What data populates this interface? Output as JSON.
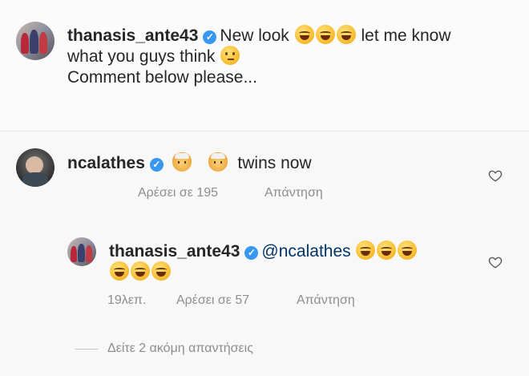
{
  "post": {
    "username": "thanasis_ante43",
    "caption_line1": "New look",
    "caption_line1b": "let me know",
    "caption_line2": "what you guys think",
    "caption_line3": "Comment below please..."
  },
  "comment": {
    "username": "ncalathes",
    "text": "twins now",
    "likes": "Αρέσει σε 195",
    "reply_label": "Απάντηση"
  },
  "reply": {
    "username": "thanasis_ante43",
    "mention": "@ncalathes",
    "time": "19λεπ.",
    "likes": "Αρέσει σε 57",
    "reply_label": "Απάντηση"
  },
  "view_more": "Δείτε 2 ακόμη απαντήσεις",
  "colors": {
    "verified": "#3897f0",
    "meta": "#8e8e8e",
    "mention": "#003569"
  },
  "icons": [
    "verified-badge-icon",
    "laughing-emoji-icon",
    "thinking-emoji-icon",
    "older-man-emoji-icon",
    "heart-icon"
  ]
}
